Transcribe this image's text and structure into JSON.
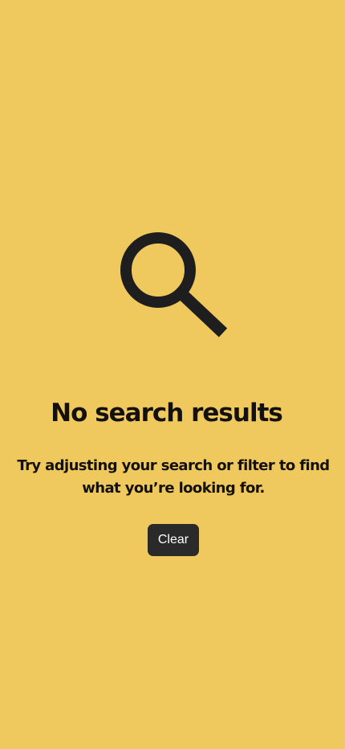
{
  "empty_state": {
    "icon": "search-icon",
    "title": "No search results",
    "message": "Try adjusting your search or filter to find what you’re looking for.",
    "clear_label": "Clear"
  },
  "colors": {
    "background": "#EFC85E",
    "text": "#14110C",
    "button_background": "#2A2A2A",
    "button_text": "#FFFFFF"
  }
}
